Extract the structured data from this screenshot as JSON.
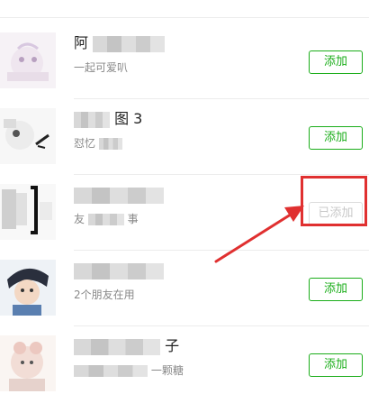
{
  "contacts": [
    {
      "name_visible": "阿",
      "name_tail": "",
      "subtitle_visible": "一起可爱叭",
      "subtitle_tail": "",
      "button_label": "添加",
      "added": false
    },
    {
      "name_visible": "",
      "name_tail": "图 3",
      "subtitle_visible": "怼忆",
      "subtitle_tail": "",
      "button_label": "添加",
      "added": false
    },
    {
      "name_visible": "",
      "name_tail": "",
      "subtitle_visible": "友",
      "subtitle_tail": "事",
      "button_label": "已添加",
      "added": true
    },
    {
      "name_visible": "",
      "name_tail": "",
      "subtitle_visible": "2个朋友在用",
      "subtitle_tail": "",
      "button_label": "添加",
      "added": false
    },
    {
      "name_visible": "",
      "name_tail": "子",
      "subtitle_visible": "",
      "subtitle_tail": "一颗糖",
      "button_label": "添加",
      "added": false
    }
  ],
  "colors": {
    "accent_green": "#1aad19",
    "annotation_red": "#e03030",
    "disabled_gray": "#c8c8c8"
  },
  "annotation": {
    "target": "contacts.2.button_label",
    "shape": "box-with-arrow"
  }
}
